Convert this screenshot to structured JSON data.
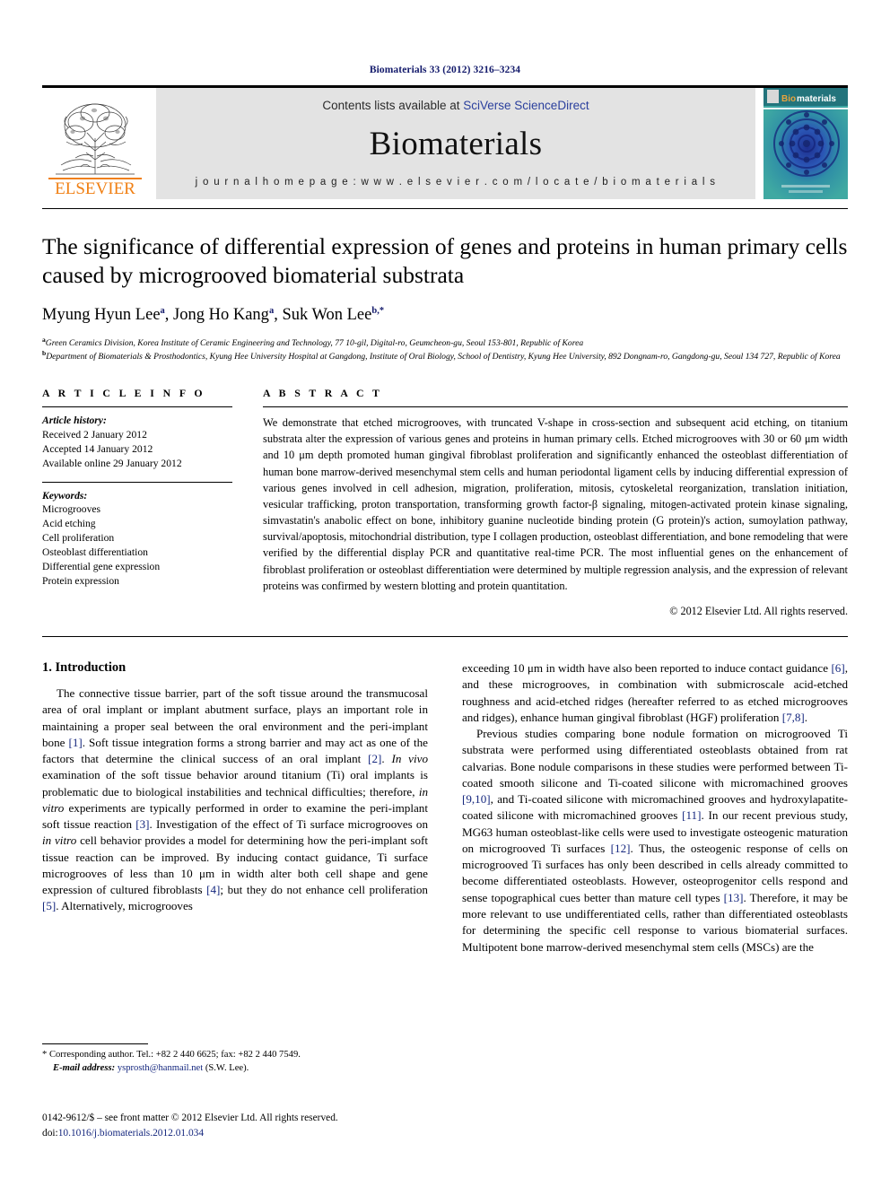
{
  "running_head": "Biomaterials 33 (2012) 3216–3234",
  "masthead": {
    "publisher_name": "ELSEVIER",
    "contents_prefix": "Contents lists available at ",
    "contents_link": "SciVerse ScienceDirect",
    "journal_name": "Biomaterials",
    "homepage_line": "j o u r n a l   h o m e p a g e :   w w w . e l s e v i e r . c o m / l o c a t e / b i o m a t e r i a l s",
    "cover_title": "Biomaterials",
    "cover_title_first": "Bio",
    "cover_title_rest": "materials"
  },
  "article": {
    "title": "The significance of differential expression of genes and proteins in human primary cells caused by microgrooved biomaterial substrata",
    "authors_plain": "Myung Hyun Lee a, Jong Ho Kang a, Suk Won Lee b,*",
    "authors": [
      {
        "name": "Myung Hyun Lee",
        "sup": "a",
        "sep": ", "
      },
      {
        "name": "Jong Ho Kang",
        "sup": "a",
        "sep": ", "
      },
      {
        "name": "Suk Won Lee",
        "sup": "b,*",
        "sep": ""
      }
    ],
    "affiliation_a": "Green Ceramics Division, Korea Institute of Ceramic Engineering and Technology, 77 10-gil, Digital-ro, Geumcheon-gu, Seoul 153-801, Republic of Korea",
    "affiliation_b": "Department of Biomaterials & Prosthodontics, Kyung Hee University Hospital at Gangdong, Institute of Oral Biology, School of Dentistry, Kyung Hee University, 892 Dongnam-ro, Gangdong-gu, Seoul 134 727, Republic of Korea",
    "affiliation_a_sup": "a",
    "affiliation_b_sup": "b"
  },
  "article_info": {
    "heading": "A R T I C L E   I N F O",
    "history_label": "Article history:",
    "history": [
      "Received 2 January 2012",
      "Accepted 14 January 2012",
      "Available online 29 January 2012"
    ],
    "keywords_label": "Keywords:",
    "keywords": [
      "Microgrooves",
      "Acid etching",
      "Cell proliferation",
      "Osteoblast differentiation",
      "Differential gene expression",
      "Protein expression"
    ]
  },
  "abstract": {
    "heading": "A B S T R A C T",
    "text": "We demonstrate that etched microgrooves, with truncated V-shape in cross-section and subsequent acid etching, on titanium substrata alter the expression of various genes and proteins in human primary cells. Etched microgrooves with 30 or 60 μm width and 10 μm depth promoted human gingival fibroblast proliferation and significantly enhanced the osteoblast differentiation of human bone marrow-derived mesenchymal stem cells and human periodontal ligament cells by inducing differential expression of various genes involved in cell adhesion, migration, proliferation, mitosis, cytoskeletal reorganization, translation initiation, vesicular trafficking, proton transportation, transforming growth factor-β signaling, mitogen-activated protein kinase signaling, simvastatin's anabolic effect on bone, inhibitory guanine nucleotide binding protein (G protein)'s action, sumoylation pathway, survival/apoptosis, mitochondrial distribution, type I collagen production, osteoblast differentiation, and bone remodeling that were verified by the differential display PCR and quantitative real-time PCR. The most influential genes on the enhancement of fibroblast proliferation or osteoblast differentiation were determined by multiple regression analysis, and the expression of relevant proteins was confirmed by western blotting and protein quantitation.",
    "copyright": "© 2012 Elsevier Ltd. All rights reserved."
  },
  "body": {
    "section_title": "1. Introduction",
    "left_paragraphs": [
      "The connective tissue barrier, part of the soft tissue around the transmucosal area of oral implant or implant abutment surface, plays an important role in maintaining a proper seal between the oral environment and the peri-implant bone [1]. Soft tissue integration forms a strong barrier and may act as one of the factors that determine the clinical success of an oral implant [2]. In vivo examination of the soft tissue behavior around titanium (Ti) oral implants is problematic due to biological instabilities and technical difficulties; therefore, in vitro experiments are typically performed in order to examine the peri-implant soft tissue reaction [3]. Investigation of the effect of Ti surface microgrooves on in vitro cell behavior provides a model for determining how the peri-implant soft tissue reaction can be improved. By inducing contact guidance, Ti surface microgrooves of less than 10 μm in width alter both cell shape and gene expression of cultured fibroblasts [4]; but they do not enhance cell proliferation [5]. Alternatively, microgrooves"
    ],
    "right_paragraphs": [
      "exceeding 10 μm in width have also been reported to induce contact guidance [6], and these microgrooves, in combination with submicroscale acid-etched roughness and acid-etched ridges (hereafter referred to as etched microgrooves and ridges), enhance human gingival fibroblast (HGF) proliferation [7,8].",
      "Previous studies comparing bone nodule formation on microgrooved Ti substrata were performed using differentiated osteoblasts obtained from rat calvarias. Bone nodule comparisons in these studies were performed between Ti-coated smooth silicone and Ti-coated silicone with micromachined grooves [9,10], and Ti-coated silicone with micromachined grooves and hydroxylapatite-coated silicone with micromachined grooves [11]. In our recent previous study, MG63 human osteoblast-like cells were used to investigate osteogenic maturation on microgrooved Ti surfaces [12]. Thus, the osteogenic response of cells on microgrooved Ti surfaces has only been described in cells already committed to become differentiated osteoblasts. However, osteoprogenitor cells respond and sense topographical cues better than mature cell types [13]. Therefore, it may be more relevant to use undifferentiated cells, rather than differentiated osteoblasts for determining the specific cell response to various biomaterial surfaces. Multipotent bone marrow-derived mesenchymal stem cells (MSCs) are the"
    ]
  },
  "footnote": {
    "corresponding": "* Corresponding author. Tel.: +82 2 440 6625; fax: +82 2 440 7549.",
    "email_label": "E-mail address:",
    "email": "ysprosth@hanmail.net",
    "email_owner": "(S.W. Lee)."
  },
  "bottom": {
    "issn_line": "0142-9612/$ – see front matter © 2012 Elsevier Ltd. All rights reserved.",
    "doi_prefix": "doi:",
    "doi": "10.1016/j.biomaterials.2012.01.034"
  },
  "colors": {
    "link_blue": "#2a3f9d",
    "ref_blue": "#15277e",
    "elsevier_orange": "#f07f13",
    "masthead_gray": "#e3e3e3"
  }
}
